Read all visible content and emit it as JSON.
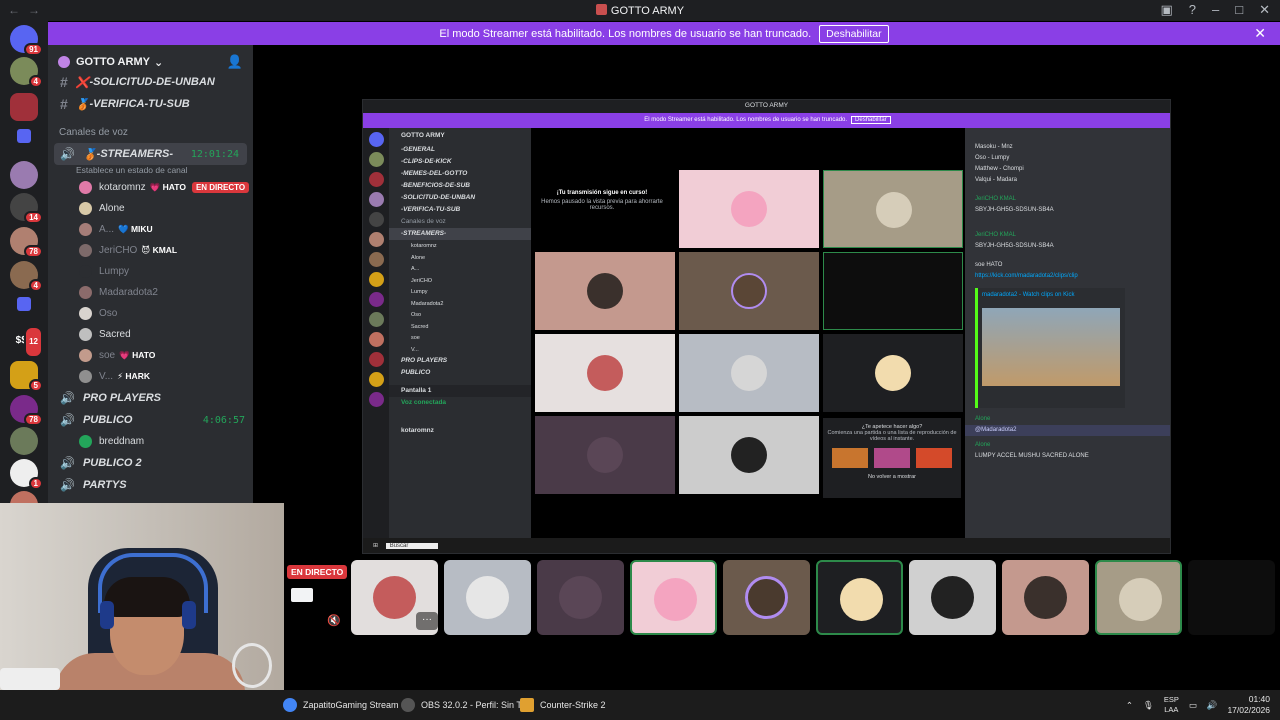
{
  "window": {
    "title": "GOTTO ARMY"
  },
  "banner": {
    "text": "El modo Streamer está habilitado. Los nombres de usuario se han truncado.",
    "button": "Deshabilitar"
  },
  "rail": {
    "badges": [
      "91",
      "4",
      "14",
      "14",
      "78",
      "4",
      "12",
      "5",
      "78",
      "1"
    ],
    "text_server": "$$$"
  },
  "sidebar": {
    "server_name": "GOTTO ARMY",
    "channels": [
      {
        "emoji": "❌",
        "name": "-SOLICITUD-DE-UNBAN"
      },
      {
        "emoji": "🥉",
        "name": "-VERIFICA-TU-SUB"
      }
    ],
    "voice_category": "Canales de voz",
    "active_voice": {
      "emoji": "🥉",
      "name": "-STREAMERS-",
      "timer": "12:01:24",
      "status": "Establece un estado de canal"
    },
    "users": [
      {
        "name": "kotaromnz",
        "tag": "💗 HATO",
        "live": "EN DIRECTO",
        "color": "#e07aa8"
      },
      {
        "name": "Alone",
        "tag": "",
        "live": "",
        "color": "#d8c9a8"
      },
      {
        "name": "A...",
        "tag": "💙 MIKU",
        "live": "",
        "color": "#a57d78"
      },
      {
        "name": "JeriCHO",
        "tag": "😈 KMAL",
        "live": "",
        "color": "#7d6a6a"
      },
      {
        "name": "Lumpy",
        "tag": "",
        "live": "",
        "color": "#2b2d31"
      },
      {
        "name": "Madaradota2",
        "tag": "",
        "live": "",
        "color": "#8b6b6b"
      },
      {
        "name": "Oso",
        "tag": "",
        "live": "",
        "color": "#d9d4cf"
      },
      {
        "name": "Sacred",
        "tag": "",
        "live": "",
        "color": "#bfbfbf"
      },
      {
        "name": "soe",
        "tag": "💗 HATO",
        "live": "",
        "color": "#c29b8c"
      },
      {
        "name": "V...",
        "tag": "⚡ HARK",
        "live": "",
        "color": "#8f8f8f"
      }
    ],
    "other_voice": [
      {
        "name": "PRO PLAYERS",
        "timer": ""
      },
      {
        "name": "PUBLICO",
        "timer": "4:06:57"
      }
    ],
    "publico_user": "breddnam",
    "publico2": "PUBLICO 2",
    "party": "PARTYS"
  },
  "share": {
    "title": "GOTTO ARMY",
    "banner": "El modo Streamer está habilitado. Los nombres de usuario se han truncado.",
    "banner_btn": "Deshabilitar",
    "side_lines": [
      "GOTTO ARMY",
      "-GENERAL",
      "-CLIPS-DE-KICK",
      "-MEMES-DEL-GOTTO",
      "-BENEFICIOS-DE-SUB",
      "-SOLICITUD-DE-UNBAN",
      "-VERIFICA-TU-SUB",
      "Canales de voz",
      "-STREAMERS-",
      "kotaromnz",
      "Alone",
      "A...",
      "JeriCHO",
      "Lumpy",
      "Madaradota2",
      "Oso",
      "Sacred",
      "soe",
      "V...",
      "PRO PLAYERS",
      "PUBLICO",
      "Pantalla 1",
      "Voz conectada",
      "kotaromnz"
    ],
    "stream_note": "¡Tu transmisión sigue en curso!",
    "stream_sub": "Hemos pausado la vista previa para ahorrarte recursos.",
    "chat_lines": [
      "Masoku - Mnz",
      "Oso - Lumpy",
      "Matthew - Chompi",
      "Valqui - Madara",
      "JeriCHO KMAL",
      "SBYJH-GH5G-SDSUN-SB4A",
      "soe HATO",
      "https://kick.com/madaradota2/clips/clip",
      "madaradota2 - Watch clips on Kick",
      "Alone",
      "@Madaradota2",
      "LUMPY ACCEL MUSHU SACRED ALONE"
    ],
    "promo": "¿Te apetece hacer algo?",
    "promo_sub": "Comienza una partida o una lista de reproducción de vídeos al instante.",
    "no_show": "No volver a mostrar",
    "search": "Buscar"
  },
  "strip": {
    "live": "EN DIRECTO",
    "more": "···"
  },
  "taskbar": {
    "apps": [
      {
        "name": "ZapatitoGaming Stream",
        "color": "#4285f4"
      },
      {
        "name": "OBS 32.0.2 - Perfil: Sin T",
        "color": "#555"
      },
      {
        "name": "Counter-Strike 2",
        "color": "#e0a030"
      }
    ],
    "lang_1": "ESP",
    "lang_2": "LAA",
    "time": "01:40",
    "date": "17/02/2026"
  },
  "colors": {
    "brand": "#8a3fe6",
    "live": "#da373c",
    "voice_green": "#23a55a"
  }
}
